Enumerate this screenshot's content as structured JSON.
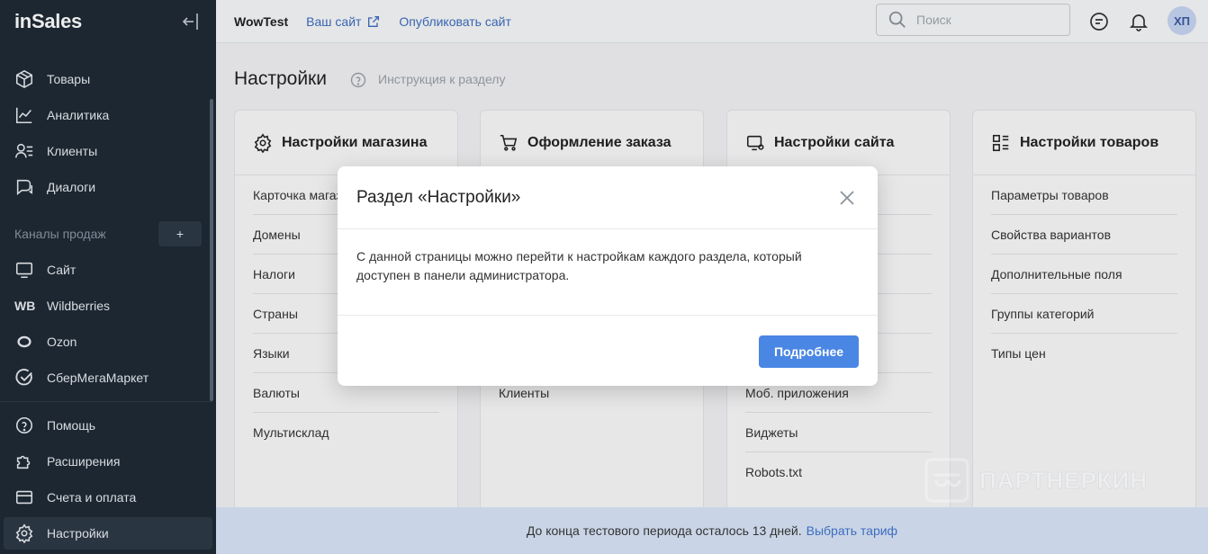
{
  "sidebar": {
    "logo": "inSales",
    "items": [
      {
        "label": "Товары",
        "icon": "box-icon"
      },
      {
        "label": "Аналитика",
        "icon": "chart-line-icon"
      },
      {
        "label": "Клиенты",
        "icon": "users-icon"
      },
      {
        "label": "Диалоги",
        "icon": "chat-icon"
      }
    ],
    "channels_title": "Каналы продаж",
    "add_channel": "+",
    "channels": [
      {
        "label": "Сайт",
        "icon": "monitor-icon"
      },
      {
        "label": "Wildberries",
        "icon": "wb-icon",
        "badge": "WB"
      },
      {
        "label": "Ozon",
        "icon": "ozon-icon"
      },
      {
        "label": "СберМегаМаркет",
        "icon": "sber-icon"
      }
    ],
    "bottom": [
      {
        "label": "Помощь",
        "icon": "help-circle-icon"
      },
      {
        "label": "Расширения",
        "icon": "puzzle-icon"
      },
      {
        "label": "Счета и оплата",
        "icon": "card-icon"
      },
      {
        "label": "Настройки",
        "icon": "gear-icon",
        "active": true
      }
    ]
  },
  "topbar": {
    "shop_name": "WowTest",
    "your_site": "Ваш сайт",
    "publish": "Опубликовать сайт",
    "search_placeholder": "Поиск",
    "avatar": "ХП"
  },
  "main": {
    "title": "Настройки",
    "help_link": "Инструкция к разделу",
    "cards": [
      {
        "title": "Настройки магазина",
        "icon": "gear-icon",
        "items": [
          "Карточка магазина",
          "Домены",
          "Налоги",
          "Страны",
          "Языки",
          "Валюты",
          "Мультисклад"
        ]
      },
      {
        "title": "Оформление заказа",
        "icon": "cart-icon",
        "items": [
          "",
          "",
          "",
          "",
          "",
          "Клиенты"
        ]
      },
      {
        "title": "Настройки сайта",
        "icon": "site-settings-icon",
        "items": [
          "",
          "",
          "",
          "",
          "",
          "Моб. приложения",
          "Виджеты",
          "Robots.txt"
        ]
      },
      {
        "title": "Настройки товаров",
        "icon": "product-grid-icon",
        "items": [
          "Параметры товаров",
          "Свойства вариантов",
          "Дополнительные поля",
          "Группы категорий",
          "Типы цен"
        ]
      }
    ]
  },
  "modal": {
    "title": "Раздел «Настройки»",
    "body": "С данной страницы можно перейти к настройкам каждого раздела, который доступен в панели администратора.",
    "button": "Подробнее"
  },
  "banner": {
    "text": "До конца тестового периода осталось 13 дней.",
    "link": "Выбрать тариф"
  },
  "watermark": "ПАРТНЕРКИН",
  "colors": {
    "sidebar": "#1f2a36",
    "accent": "#4a86e4",
    "link": "#3d6cc0",
    "banner": "#c9d5e6"
  }
}
